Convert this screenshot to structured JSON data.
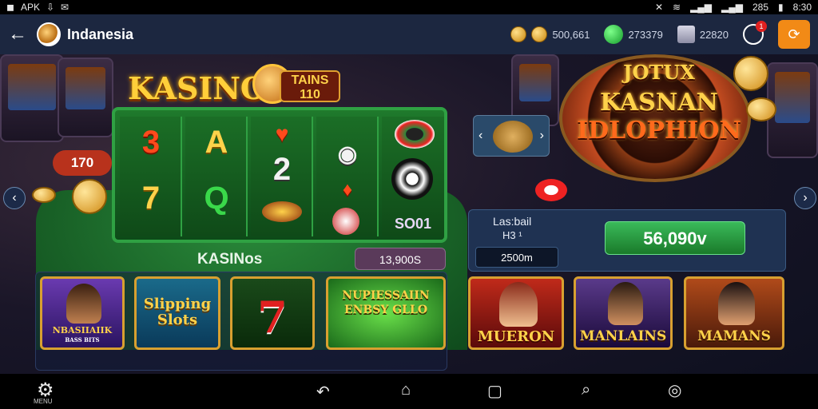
{
  "status_bar": {
    "left_text": "APK",
    "right_text": "8:30",
    "battery_text": "285"
  },
  "header": {
    "title": "Indanesia",
    "stats": [
      {
        "icon": "coins-icon",
        "value": "500,661"
      },
      {
        "icon": "gem-icon",
        "value": "273379"
      },
      {
        "icon": "crate-icon",
        "value": "22820"
      }
    ],
    "notif_count": "1",
    "accent": "#f28a16"
  },
  "slot_area": {
    "title": "KASINO",
    "sign": "TAINS 110",
    "left_pill": "170",
    "reels": [
      [
        "3",
        "7"
      ],
      [
        "A",
        "Q"
      ],
      [
        "♥",
        "2"
      ],
      [
        "◉",
        "♦"
      ],
      [
        "●",
        "SO01"
      ]
    ],
    "label": "KASINos",
    "amount": "13,900S"
  },
  "roulette": {
    "line1": "JOTUX",
    "line2": "KASNAN",
    "line3": "IDLOPHION"
  },
  "panel": {
    "label1": "Las:bail",
    "label2": "H3 ¹",
    "small_value": "2500m",
    "big_value": "56,090v"
  },
  "tiles": [
    {
      "label": "NBASIIAIIK",
      "sub": "BASS BITS"
    },
    {
      "label": "Slipping Slots"
    },
    {
      "label": "7"
    },
    {
      "label": "NUPIESSAIIN ENBSY GLLO"
    },
    {
      "label": "MUERON"
    },
    {
      "label": "MANLAINS"
    },
    {
      "label": "MAMANS"
    }
  ],
  "nav": {
    "home_label": "MENU"
  }
}
